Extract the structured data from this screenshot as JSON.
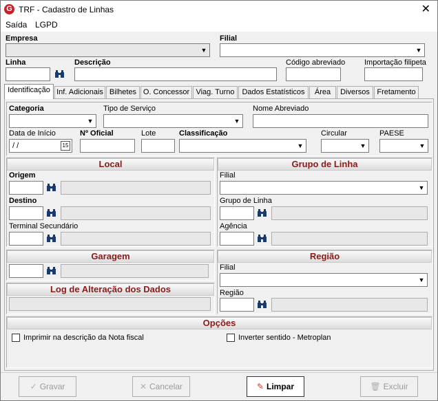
{
  "window": {
    "title": "TRF - Cadastro de Linhas",
    "app_icon": "G"
  },
  "menu": [
    "Saída",
    "LGPD"
  ],
  "header": {
    "empresa_label": "Empresa",
    "filial_label": "Filial",
    "linha_label": "Linha",
    "descricao_label": "Descrição",
    "codigo_abreviado_label": "Código abreviado",
    "importacao_label": "Importação filipeta"
  },
  "tabs": [
    "Identificação",
    "Inf. Adicionais",
    "Bilhetes",
    "O. Concessor",
    "Viag. Turno",
    "Dados Estatísticos",
    "Área",
    "Diversos",
    "Fretamento"
  ],
  "ident": {
    "categoria_label": "Categoria",
    "tipo_servico_label": "Tipo de Serviço",
    "nome_abreviado_label": "Nome Abreviado",
    "data_inicio_label": "Data de Início",
    "data_inicio_value": " / /",
    "calendar_day": "15",
    "oficial_label": "Nº Oficial",
    "lote_label": "Lote",
    "classificacao_label": "Classificação",
    "circular_label": "Circular",
    "paese_label": "PAESE"
  },
  "local": {
    "title": "Local",
    "origem_label": "Origem",
    "destino_label": "Destino",
    "terminal_label": "Terminal Secundário"
  },
  "grupo": {
    "title": "Grupo de Linha",
    "filial_label": "Filial",
    "grupo_label": "Grupo de Linha",
    "agencia_label": "Agência"
  },
  "garagem": {
    "title": "Garagem"
  },
  "log": {
    "title": "Log de Alteração dos Dados"
  },
  "regiao": {
    "title": "Região",
    "filial_label": "Filial",
    "regiao_label": "Região"
  },
  "opcoes": {
    "title": "Opções",
    "opt1": "Imprimir na descrição da Nota fiscal",
    "opt2": "Inverter sentido - Metroplan"
  },
  "buttons": {
    "gravar": "Gravar",
    "cancelar": "Cancelar",
    "limpar": "Limpar",
    "excluir": "Excluir"
  },
  "colors": {
    "section_title": "#8b1a1a",
    "app_icon_red": "#c8202a"
  }
}
